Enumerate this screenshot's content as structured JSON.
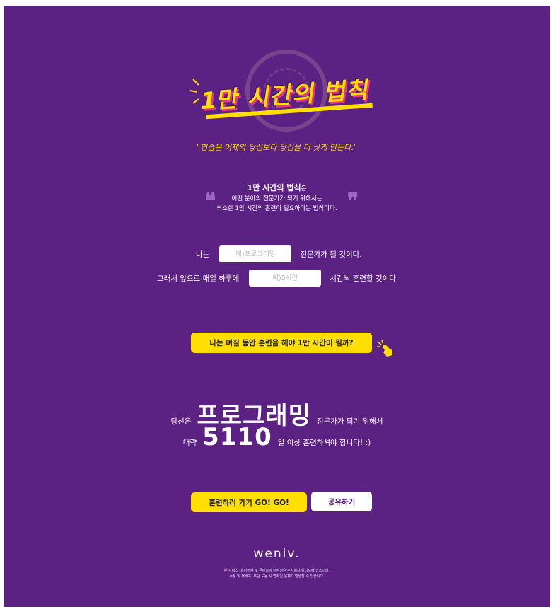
{
  "logo": {
    "title": "1만 시간의 법칙"
  },
  "quote": "\"연습은 어제의 당신보다 당신을 더 낫게 만든다.\"",
  "definition": {
    "open_quote": "❝",
    "close_quote": "❞",
    "strong": "1만 시간의 법칙",
    "strong_suffix": "은",
    "line1": "어떤 분야의 전문가가 되기 위해서는",
    "line2": "최소한 1만 시간의 훈련이 필요하다는 법칙이다."
  },
  "form": {
    "field_prefix": "나는",
    "field_placeholder": "예)프로그래밍",
    "field_suffix": "전문가가 될 것이다.",
    "time_prefix": "그래서 앞으로 매일 하루에",
    "time_placeholder": "예)5시간",
    "time_suffix": "시간씩 훈련할 것이다."
  },
  "calc_button": "나는 며칠 동안 훈련을 해야 1만 시간이 될까?",
  "result": {
    "prefix": "당신은",
    "field": "프로그래밍",
    "field_suffix": "전문가가 되기 위해서",
    "days_prefix": "대략",
    "days": "5110",
    "days_suffix": "일 이상 훈련하셔야 합니다! :)"
  },
  "actions": {
    "go": "훈련하러 가기 GO! GO!",
    "share": "공유하기"
  },
  "footer": {
    "brand": "weniv.",
    "copyright_line1": "본 서비스 내 이미지 및 콘텐츠의 저작권은 주식회사 위니브에 있습니다.",
    "copyright_line2": "수정 및 재배포, 무단 도용 시 법적인 문제가 발생할 수 있습니다."
  },
  "colors": {
    "background": "#5b2183",
    "accent": "#ffde00",
    "pink": "#e8358d"
  }
}
